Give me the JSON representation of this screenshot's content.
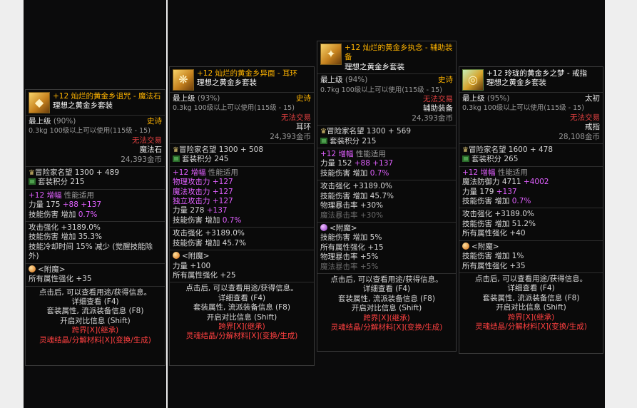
{
  "cards": [
    {
      "title": "+12 灿烂的黄金乡诅咒 - 魔法石",
      "set": "理想之黄金乡套装",
      "grade": "最上级",
      "grade_pct": "(90%)",
      "rarity": "史诗",
      "weight": "0.3kg",
      "level_req": "100级以上可以使用(115级 - 15)",
      "trade": "无法交易",
      "slot": "魔法石",
      "price": "24,393金币",
      "adventurer": "冒险家名望 1300 + 489",
      "set_points": "套装积分 215",
      "amp_label": "+12 增幅",
      "amp_note": "性能适用",
      "stats1": [
        "力量 175 +88 +137",
        "技能伤害 增加 0.7%"
      ],
      "stats2": [
        "攻击强化 +3189.0%",
        "技能伤害 增加 35.3%",
        "技能冷却时间 15% 减少 (觉醒技能除外)"
      ],
      "enchant_title": "<附魔>",
      "enchant": [
        "所有属性强化 +35"
      ],
      "footer": [
        "点击后, 可以查看用途/获得信息。",
        "详细查看 (F4)",
        "套装属性, 流派装备信息 (F8)",
        "开启对比信息 (Shift)",
        "跨界[X](继承)",
        "灵魂结晶/分解材料[X](变换/生成)"
      ]
    },
    {
      "title": "+12 灿烂的黄金乡异面 - 耳环",
      "set": "理想之黄金乡套装",
      "grade": "最上级",
      "grade_pct": "(93%)",
      "rarity": "史诗",
      "weight": "0.3kg",
      "level_req": "100级以上可以使用(115级 - 15)",
      "trade": "无法交易",
      "slot": "耳环",
      "price": "24,393金币",
      "adventurer": "冒险家名望 1300 + 508",
      "set_points": "套装积分 245",
      "amp_label": "+12 增幅",
      "amp_note": "性能适用",
      "stats_pink": [
        "物理攻击力 +127",
        "魔法攻击力 +127",
        "独立攻击力 +127"
      ],
      "stats1": [
        "力量 278 +137",
        "技能伤害 增加 0.7%"
      ],
      "stats2": [
        "攻击强化 +3189.0%",
        "技能伤害 增加 45.7%"
      ],
      "enchant_title": "<附魔>",
      "enchant": [
        "力量 +100",
        "所有属性强化 +25"
      ],
      "footer": [
        "点击后, 可以查看用途/获得信息。",
        "详细查看 (F4)",
        "套装属性, 流派装备信息 (F8)",
        "开启对比信息 (Shift)",
        "跨界[X](继承)",
        "灵魂结晶/分解材料[X](变换/生成)"
      ]
    },
    {
      "title": "+12 灿烂的黄金乡执念 - 辅助装备",
      "set": "理想之黄金乡套装",
      "grade": "最上级",
      "grade_pct": "(94%)",
      "rarity": "史诗",
      "weight": "0.7kg",
      "level_req": "100级以上可以使用(115级 - 15)",
      "trade": "无法交易",
      "slot": "辅助装备",
      "price": "24,393金币",
      "adventurer": "冒险家名望 1300 + 569",
      "set_points": "套装积分 215",
      "amp_label": "+12 增幅",
      "amp_note": "性能适用",
      "stats1": [
        "力量 152 +88 +137",
        "技能伤害 增加 0.7%"
      ],
      "stats2": [
        "攻击强化 +3189.0%",
        "技能伤害 增加 45.7%",
        "物理暴击率 +30%",
        "魔法暴击率 +30%"
      ],
      "enchant_title": "<附魔>",
      "enchant": [
        "技能伤害 增加 5%",
        "所有属性强化 +15",
        "物理暴击率 +5%",
        "魔法暴击率 +5%"
      ],
      "footer": [
        "点击后, 可以查看用途/获得信息。",
        "详细查看 (F4)",
        "套装属性, 流派装备信息 (F8)",
        "开启对比信息 (Shift)",
        "跨界[X](继承)",
        "灵魂结晶/分解材料[X](变换/生成)"
      ]
    },
    {
      "title": "+12 玲珑的黄金乡之梦 - 戒指",
      "set": "理想之黄金乡套装",
      "grade": "最上级",
      "grade_pct": "(95%)",
      "rarity": "太初",
      "weight": "0.3kg",
      "level_req": "100级以上可以使用(115级 - 15)",
      "trade": "无法交易",
      "slot": "戒指",
      "price": "28,108金币",
      "adventurer": "冒险家名望 1600 + 478",
      "set_points": "套装积分 265",
      "amp_label": "+12 增幅",
      "amp_note": "性能适用",
      "stats_defense": "魔法防御力 4711 +4002",
      "stats1": [
        "力量 179 +137",
        "技能伤害 增加 0.7%"
      ],
      "stats2": [
        "攻击强化 +3189.0%",
        "技能伤害 增加 51.2%",
        "所有属性强化 +40"
      ],
      "enchant_title": "<附魔>",
      "enchant": [
        "技能伤害 增加 1%",
        "所有属性强化 +35"
      ],
      "footer": [
        "点击后, 可以查看用途/获得信息。",
        "详细查看 (F4)",
        "套装属性, 流派装备信息 (F8)",
        "开启对比信息 (Shift)",
        "跨界[X](继承)",
        "灵魂结晶/分解材料[X](变换/生成)"
      ]
    }
  ],
  "colors": {
    "epic": "#ffb400",
    "primordial": "#ffffff",
    "trade": "#e04040",
    "amp": "#e060ff",
    "accent": "#ffc93c"
  }
}
